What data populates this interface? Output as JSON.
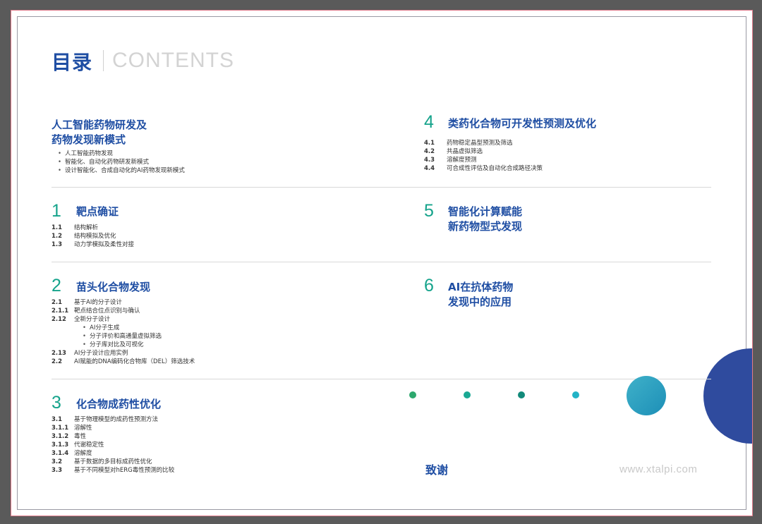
{
  "header": {
    "title_cn": "目录",
    "title_en": "CONTENTS"
  },
  "intro": {
    "title_line1": "人工智能药物研发及",
    "title_line2": "药物发现新模式",
    "bullets": [
      "人工智能药物发现",
      "智能化、自动化药物研发新模式",
      "设计智能化、合成自动化的AI药物发现新模式"
    ]
  },
  "s1": {
    "num": "1",
    "title": "靶点确证",
    "items": [
      {
        "n": "1.1",
        "t": "结构解析"
      },
      {
        "n": "1.2",
        "t": "结构模拟及优化"
      },
      {
        "n": "1.3",
        "t": "动力学模拟及柔性对接"
      }
    ]
  },
  "s2": {
    "num": "2",
    "title": "苗头化合物发现",
    "items": [
      {
        "n": "2.1",
        "t": "基于AI的分子设计"
      },
      {
        "n": "2.1.1",
        "t": "靶点结合位点识别与确认"
      },
      {
        "n": "2.12",
        "t": "全新分子设计"
      }
    ],
    "subs": [
      "AI分子生成",
      "分子评价和高通量虚拟筛选",
      "分子库对比及可视化"
    ],
    "items2": [
      {
        "n": "2.13",
        "t": "AI分子设计应用实例"
      },
      {
        "n": "2.2",
        "t": "AI赋能的DNA编码化合物库（DEL）筛选技术"
      }
    ]
  },
  "s3": {
    "num": "3",
    "title": "化合物成药性优化",
    "items": [
      {
        "n": "3.1",
        "t": "基于物理模型的成药性预测方法"
      },
      {
        "n": "3.1.1",
        "t": "溶解性"
      },
      {
        "n": "3.1.2",
        "t": "毒性"
      },
      {
        "n": "3.1.3",
        "t": "代谢稳定性"
      },
      {
        "n": "3.1.4",
        "t": "溶解度"
      },
      {
        "n": "3.2",
        "t": "基于数据的多目标成药性优化"
      },
      {
        "n": "3.3",
        "t": "基于不同模型对hERG毒性预测的比较"
      }
    ]
  },
  "s4": {
    "num": "4",
    "title": "类药化合物可开发性预测及优化",
    "items": [
      {
        "n": "4.1",
        "t": "药物稳定晶型预测及筛选"
      },
      {
        "n": "4.2",
        "t": "共晶虚拟筛选"
      },
      {
        "n": "4.3",
        "t": "溶解度预测"
      },
      {
        "n": "4.4",
        "t": "可合成性评估及自动化合成路径决策"
      }
    ]
  },
  "s5": {
    "num": "5",
    "title_line1": "智能化计算赋能",
    "title_line2": "新药物型式发现"
  },
  "s6": {
    "num": "6",
    "title_line1": "AI在抗体药物",
    "title_line2": "发现中的应用"
  },
  "footer": {
    "thanks": "致谢",
    "website": "www.xtalpi.com"
  },
  "colors": {
    "brand_blue": "#1f4ea3",
    "teal": "#15a38b",
    "circle_dark": "#2f4b9e"
  }
}
